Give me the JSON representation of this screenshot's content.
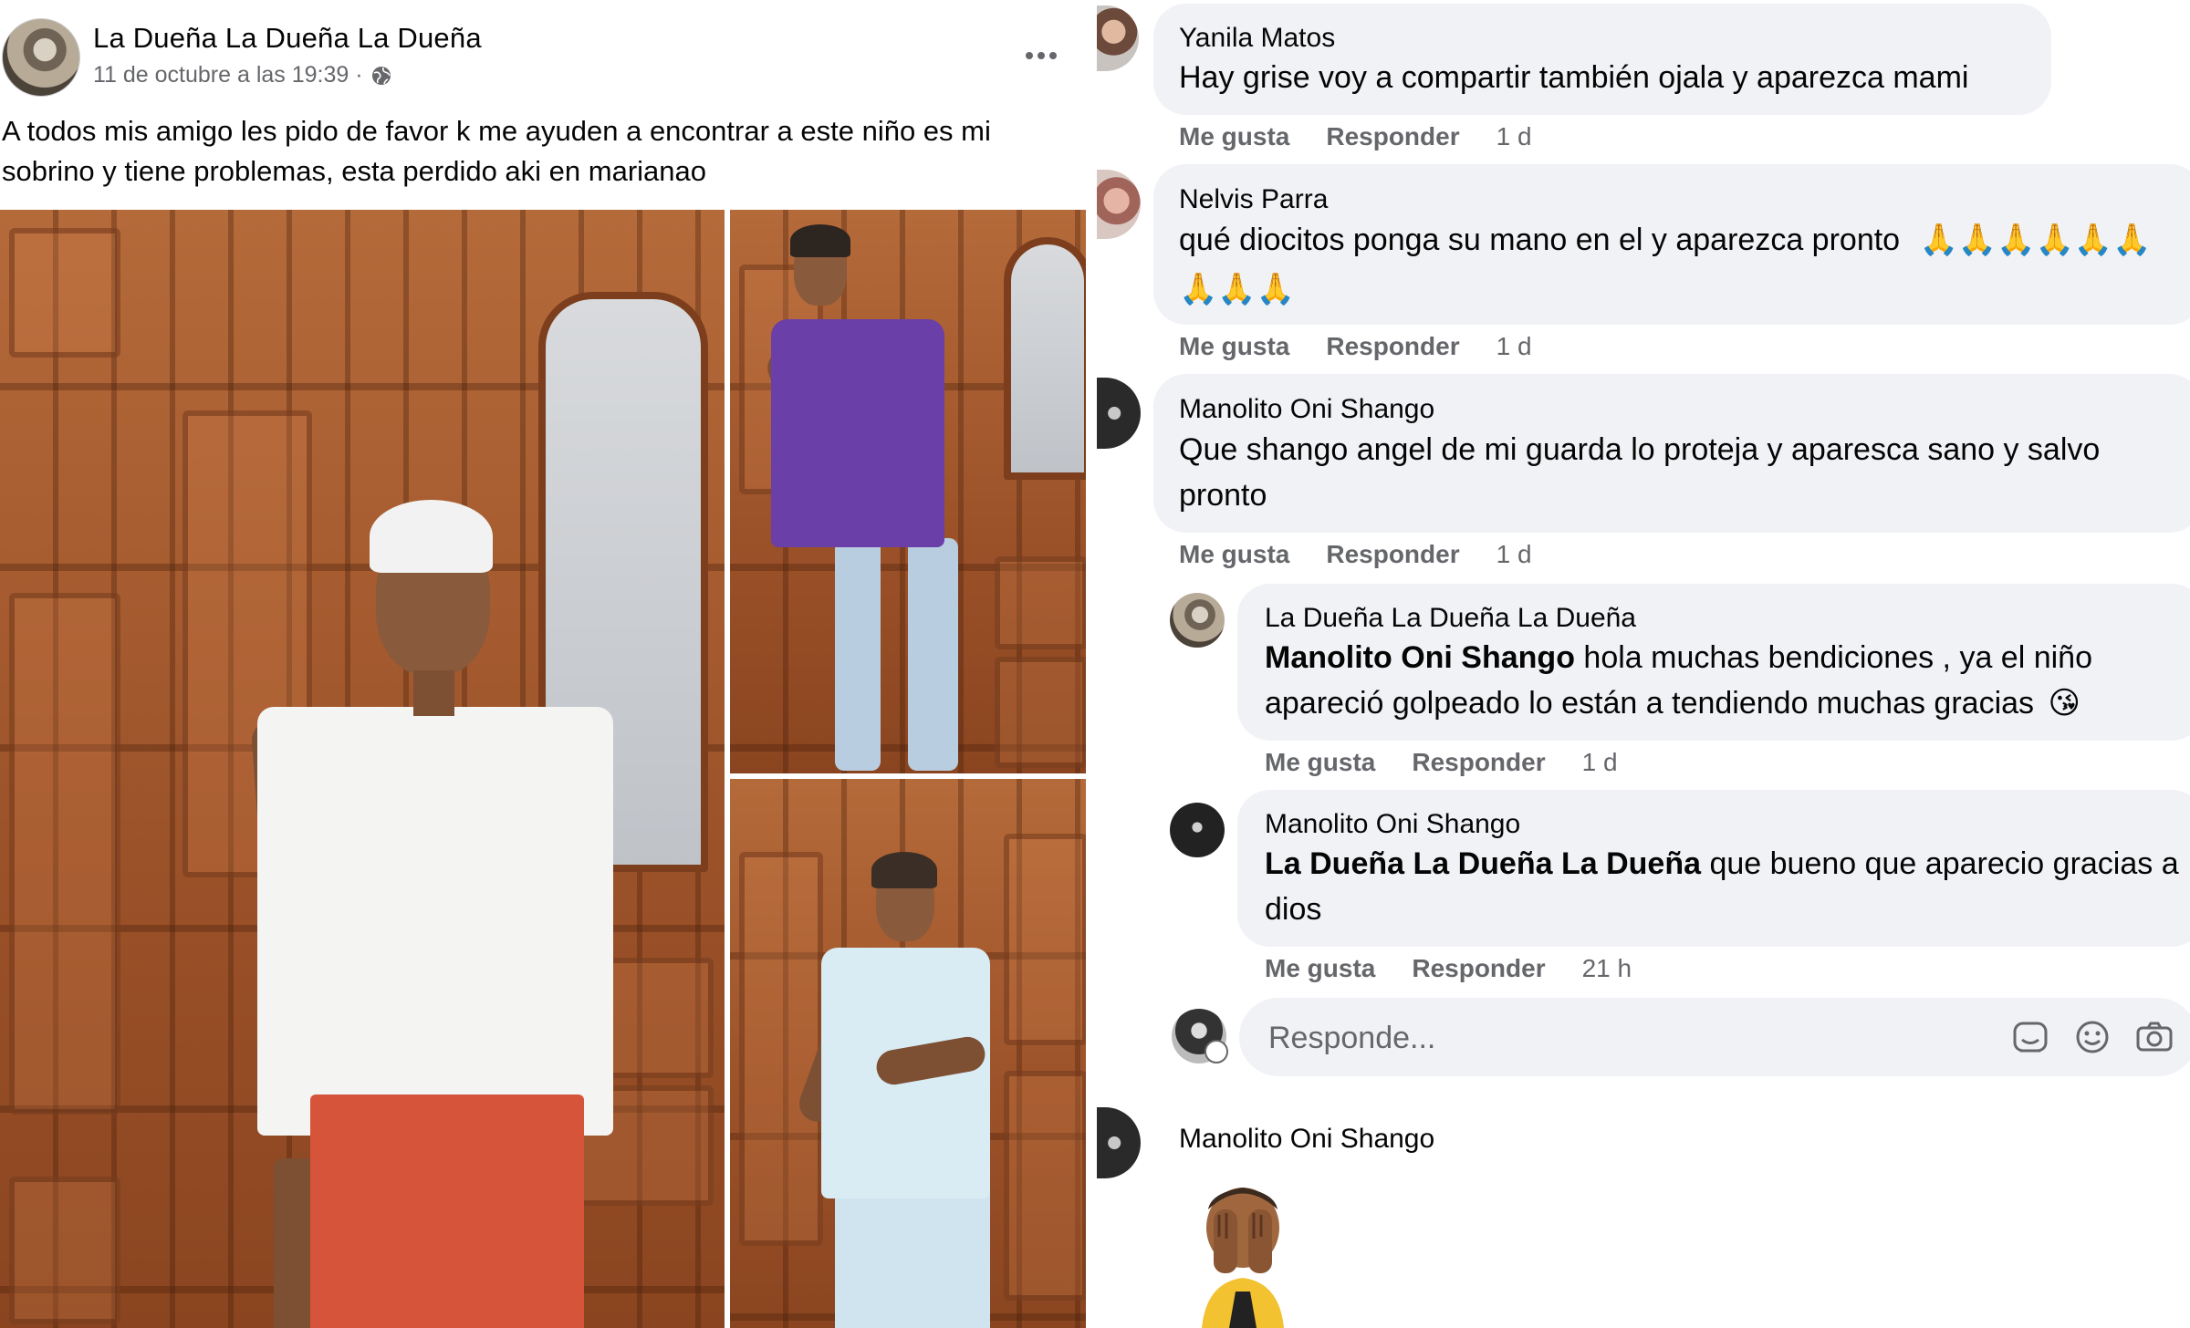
{
  "post": {
    "author": "La Dueña La Dueña La Dueña",
    "timestamp": "11 de octubre a las 19:39 ·",
    "privacy_icon": "globe-icon",
    "menu_icon": "more-options-icon",
    "text_line1": "A todos mis amigo les pido de favor k me ayuden a encontrar a este niño es mi",
    "text_line2": "sobrino y tiene problemas, esta perdido aki en marianao"
  },
  "comments": [
    {
      "name": "Yanila Matos",
      "text": "Hay grise voy a compartir también ojala y aparezca mami",
      "like": "Me gusta",
      "reply": "Responder",
      "time": "1 d"
    },
    {
      "name": "Nelvis Parra",
      "text_line1": "qué diocitos ponga su mano en el y aparezca pronto",
      "emoji_line1": "🙏🙏🙏🙏🙏🙏",
      "emoji_line2": "🙏🙏🙏",
      "like": "Me gusta",
      "reply": "Responder",
      "time": "1 d"
    },
    {
      "name": "Manolito Oni Shango",
      "text_line1": "Que shango angel de mi guarda lo proteja y aparesca sano y salvo",
      "text_line2": "pronto",
      "like": "Me gusta",
      "reply": "Responder",
      "time": "1 d"
    }
  ],
  "replies": [
    {
      "name": "La Dueña La Dueña La Dueña",
      "mention": "Manolito Oni Shango",
      "text_line1": " hola muchas bendiciones , ya el niño",
      "text_line2": "apareció golpeado lo están a tendiendo muchas gracias",
      "emoji": "😘",
      "like": "Me gusta",
      "reply": "Responder",
      "time": "1 d"
    },
    {
      "name": "Manolito Oni Shango",
      "mention": "La Dueña La Dueña La Dueña",
      "text_line1": " que bueno que aparecio gracias a",
      "text_line2": "dios",
      "like": "Me gusta",
      "reply": "Responder",
      "time": "21 h"
    }
  ],
  "reply_box": {
    "placeholder": "Responde...",
    "icons": [
      "sticker-icon",
      "emoji-icon",
      "camera-icon"
    ]
  },
  "last_comment": {
    "name": "Manolito Oni Shango",
    "sticker": "covering-eyes-sticker"
  }
}
